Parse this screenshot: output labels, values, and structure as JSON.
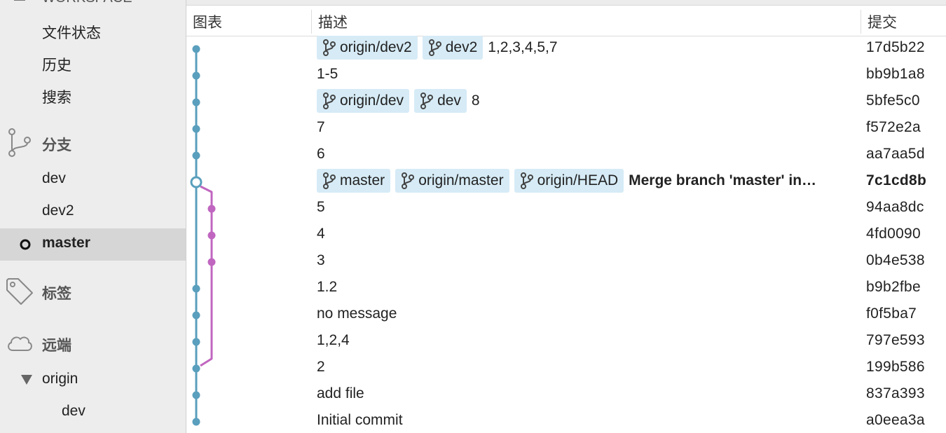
{
  "sidebar": {
    "workspace_label": "WORKSPACE",
    "workspace_items": [
      "文件状态",
      "历史",
      "搜索"
    ],
    "branches_label": "分支",
    "branches": [
      "dev",
      "dev2",
      "master"
    ],
    "selected_branch": "master",
    "tags_label": "标签",
    "remotes_label": "远端",
    "remote_name": "origin",
    "remote_branches": [
      "dev"
    ]
  },
  "columns": {
    "graph": "图表",
    "description": "描述",
    "commit": "提交"
  },
  "commits": [
    {
      "refs": [
        "origin/dev2",
        "dev2"
      ],
      "message": "1,2,3,4,5,7",
      "hash": "17d5b22"
    },
    {
      "refs": [],
      "message": "1-5",
      "hash": "bb9b1a8"
    },
    {
      "refs": [
        "origin/dev",
        "dev"
      ],
      "message": "8",
      "hash": "5bfe5c0"
    },
    {
      "refs": [],
      "message": "7",
      "hash": "f572e2a"
    },
    {
      "refs": [],
      "message": "6",
      "hash": "aa7aa5d"
    },
    {
      "refs": [
        "master",
        "origin/master",
        "origin/HEAD"
      ],
      "message": "Merge branch 'master' in…",
      "hash": "7c1cd8b",
      "bold": true
    },
    {
      "refs": [],
      "message": "5",
      "hash": "94aa8dc"
    },
    {
      "refs": [],
      "message": "4",
      "hash": "4fd0090"
    },
    {
      "refs": [],
      "message": "3",
      "hash": "0b4e538"
    },
    {
      "refs": [],
      "message": "1.2",
      "hash": "b9b2fbe"
    },
    {
      "refs": [],
      "message": "no message",
      "hash": "f0f5ba7"
    },
    {
      "refs": [],
      "message": "1,2,4",
      "hash": "797e593"
    },
    {
      "refs": [],
      "message": "2",
      "hash": "199b586"
    },
    {
      "refs": [],
      "message": "add file",
      "hash": "837a393"
    },
    {
      "refs": [],
      "message": "Initial commit",
      "hash": "a0eea3a"
    }
  ],
  "colors": {
    "main_lane": "#5a9fbd",
    "branch_lane": "#c066c0",
    "tag_bg": "#d6ebf6",
    "sidebar_bg": "#ededed",
    "selected_bg": "#d6d6d6"
  },
  "icons": [
    "workspace-icon",
    "branch-icon",
    "tag-icon",
    "cloud-icon",
    "disclosure-triangle-icon",
    "git-branch-icon",
    "current-branch-icon"
  ]
}
